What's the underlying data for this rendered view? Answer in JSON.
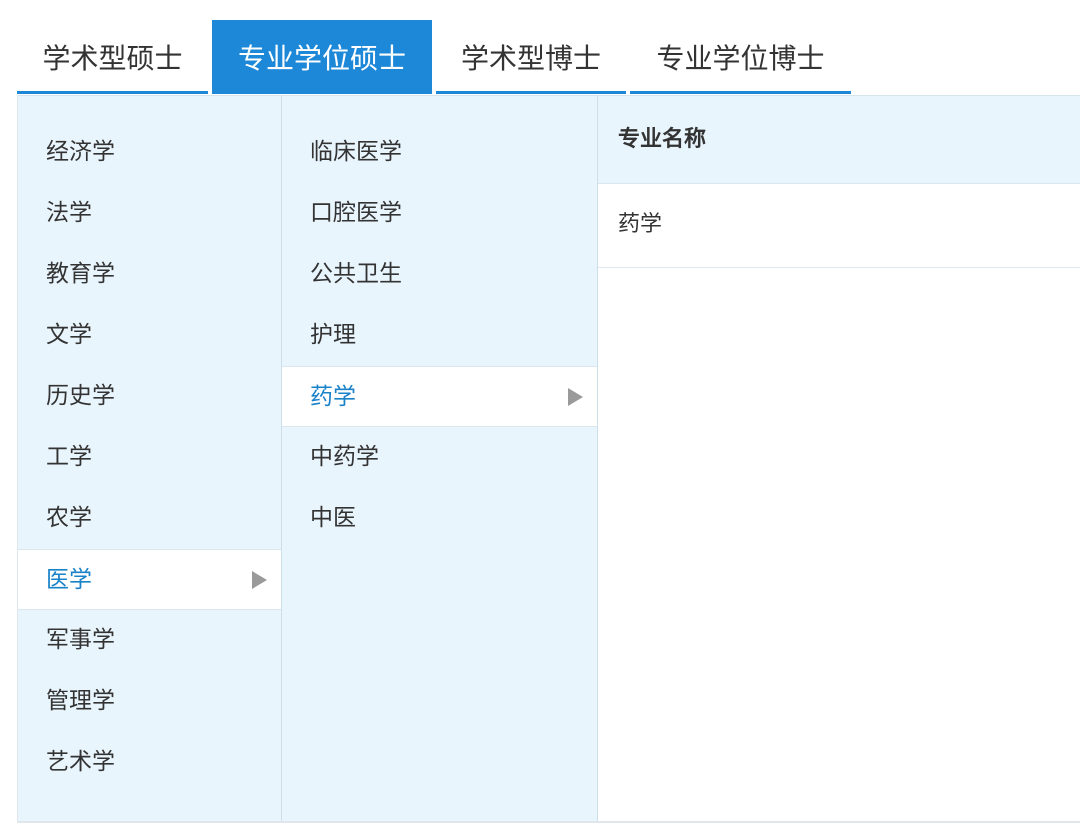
{
  "tabs": [
    {
      "label": "学术型硕士",
      "active": false
    },
    {
      "label": "专业学位硕士",
      "active": true
    },
    {
      "label": "学术型博士",
      "active": false
    },
    {
      "label": "专业学位博士",
      "active": false
    }
  ],
  "disciplines": [
    {
      "label": "经济学"
    },
    {
      "label": "法学"
    },
    {
      "label": "教育学"
    },
    {
      "label": "文学"
    },
    {
      "label": "历史学"
    },
    {
      "label": "工学"
    },
    {
      "label": "农学"
    },
    {
      "label": "医学",
      "selected": true
    },
    {
      "label": "军事学"
    },
    {
      "label": "管理学"
    },
    {
      "label": "艺术学"
    }
  ],
  "categories": [
    {
      "label": "临床医学"
    },
    {
      "label": "口腔医学"
    },
    {
      "label": "公共卫生"
    },
    {
      "label": "护理"
    },
    {
      "label": "药学",
      "selected": true
    },
    {
      "label": "中药学"
    },
    {
      "label": "中医"
    }
  ],
  "majors_table": {
    "header": "专业名称",
    "rows": [
      "药学"
    ]
  },
  "colors": {
    "accent": "#1e88d8",
    "selected_text": "#1a82c8",
    "panel_bg": "#e9f5fd"
  },
  "icons": {
    "selected_arrow": "triangle-right-icon"
  }
}
